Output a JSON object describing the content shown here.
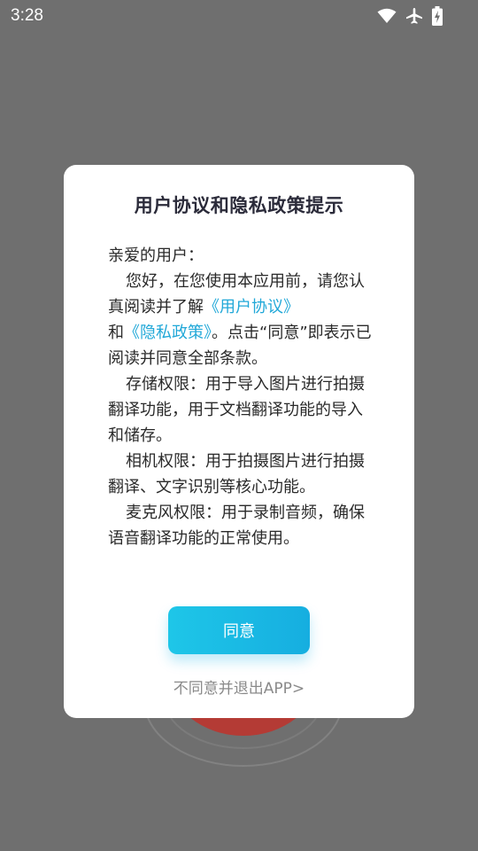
{
  "status_bar": {
    "time": "3:28",
    "icons": [
      "wifi-icon",
      "airplane-icon",
      "battery-charging-icon"
    ]
  },
  "dialog": {
    "title": "用户协议和隐私政策提示",
    "greeting": "亲爱的用户：",
    "intro_before": "您好，在您使用本应用前，请您认真阅读并了解",
    "user_agreement_link": "《用户协议》",
    "intro_and": "和",
    "privacy_policy_link": "《隐私政策》",
    "intro_after": "。点击“同意”即表示已阅读并同意全部条款。",
    "storage_permission": "存储权限：用于导入图片进行拍摄翻译功能，用于文档翻译功能的导入和储存。",
    "camera_permission": "相机权限：用于拍摄图片进行拍摄翻译、文字识别等核心功能。",
    "microphone_permission": "麦克风权限：用于录制音频，确保语音翻译功能的正常使用。",
    "agree_button": "同意",
    "disagree_link": "不同意并退出APP>"
  },
  "colors": {
    "overlay": "#6f6f6f",
    "link": "#21a8d8",
    "button": "#16aee0",
    "title": "#2b2b3a",
    "secondary_text": "#8a8a8a"
  }
}
